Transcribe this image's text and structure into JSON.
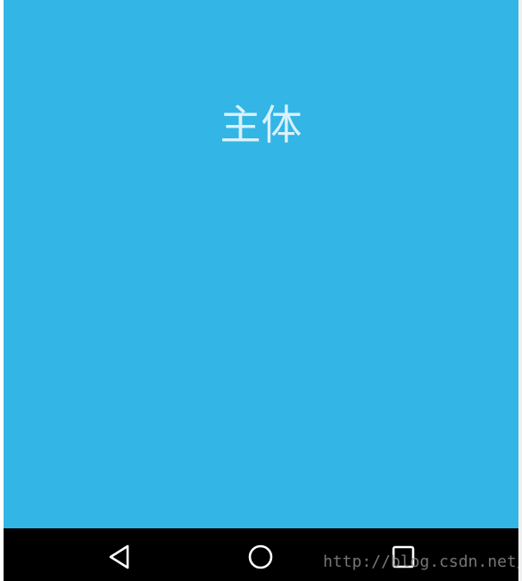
{
  "main": {
    "title": "主体",
    "background_color": "#33b5e5",
    "title_color": "#d9f1fb"
  },
  "navbar": {
    "background_color": "#000000",
    "buttons": [
      {
        "name": "back",
        "icon": "back-triangle-icon"
      },
      {
        "name": "home",
        "icon": "home-circle-icon"
      },
      {
        "name": "recent-apps",
        "icon": "recent-apps-square-icon"
      }
    ],
    "watermark": "http://blog.csdn.net/"
  }
}
